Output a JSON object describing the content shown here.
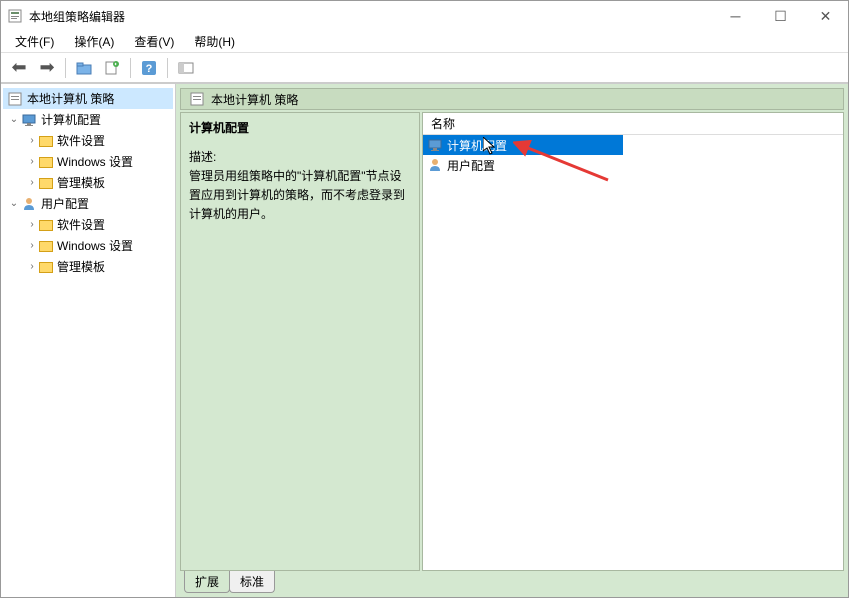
{
  "title": "本地组策略编辑器",
  "menus": {
    "file": "文件(F)",
    "action": "操作(A)",
    "view": "查看(V)",
    "help": "帮助(H)"
  },
  "tree": {
    "root": "本地计算机 策略",
    "computerConfig": "计算机配置",
    "softwareSettings": "软件设置",
    "windowsSettings": "Windows 设置",
    "adminTemplates": "管理模板",
    "userConfig": "用户配置"
  },
  "header": "本地计算机 策略",
  "desc": {
    "title": "计算机配置",
    "label": "描述:",
    "text": "管理员用组策略中的\"计算机配置\"节点设置应用到计算机的策略，而不考虑登录到计算机的用户。"
  },
  "listHeader": "名称",
  "listItems": {
    "computerConfig": "计算机配置",
    "userConfig": "用户配置"
  },
  "tabs": {
    "extended": "扩展",
    "standard": "标准"
  }
}
